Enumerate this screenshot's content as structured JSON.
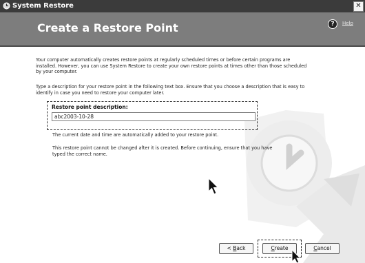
{
  "window": {
    "title": "System Restore",
    "close_glyph": "✕"
  },
  "header": {
    "heading": "Create a Restore Point",
    "help_label": "Help",
    "help_icon_glyph": "?"
  },
  "content": {
    "intro_text": "Your computer automatically creates restore points at regularly scheduled times or before certain programs are installed. However, you can use System Restore to create your own restore points at times other than those scheduled by your computer.",
    "instruction_text": "Type a description for your restore point in the following text box. Ensure that you choose a description that is easy to identify in case you need to restore your computer later.",
    "description_label": "Restore point description:",
    "description_value": "abc2003-10-28",
    "date_note": "The current date and time are automatically added to your restore point.",
    "warning_note": "This restore point cannot be changed after it is created. Before continuing, ensure that you have typed the correct name."
  },
  "buttons": {
    "back": {
      "prefix": "< ",
      "accel": "B",
      "rest": "ack"
    },
    "create": {
      "prefix": "",
      "accel": "C",
      "rest": "reate"
    },
    "cancel": {
      "prefix": "",
      "accel": "C",
      "rest": "ancel"
    }
  },
  "icons": {
    "app": "system-restore-icon",
    "help": "help-icon",
    "clock": "clock-watermark-icon",
    "arrow": "restore-arrow-watermark-icon",
    "cursor": "mouse-pointer-icon"
  },
  "colors": {
    "titlebar": "#3b3b3b",
    "banner": "#7d7d7d",
    "background": "#ffffff"
  }
}
